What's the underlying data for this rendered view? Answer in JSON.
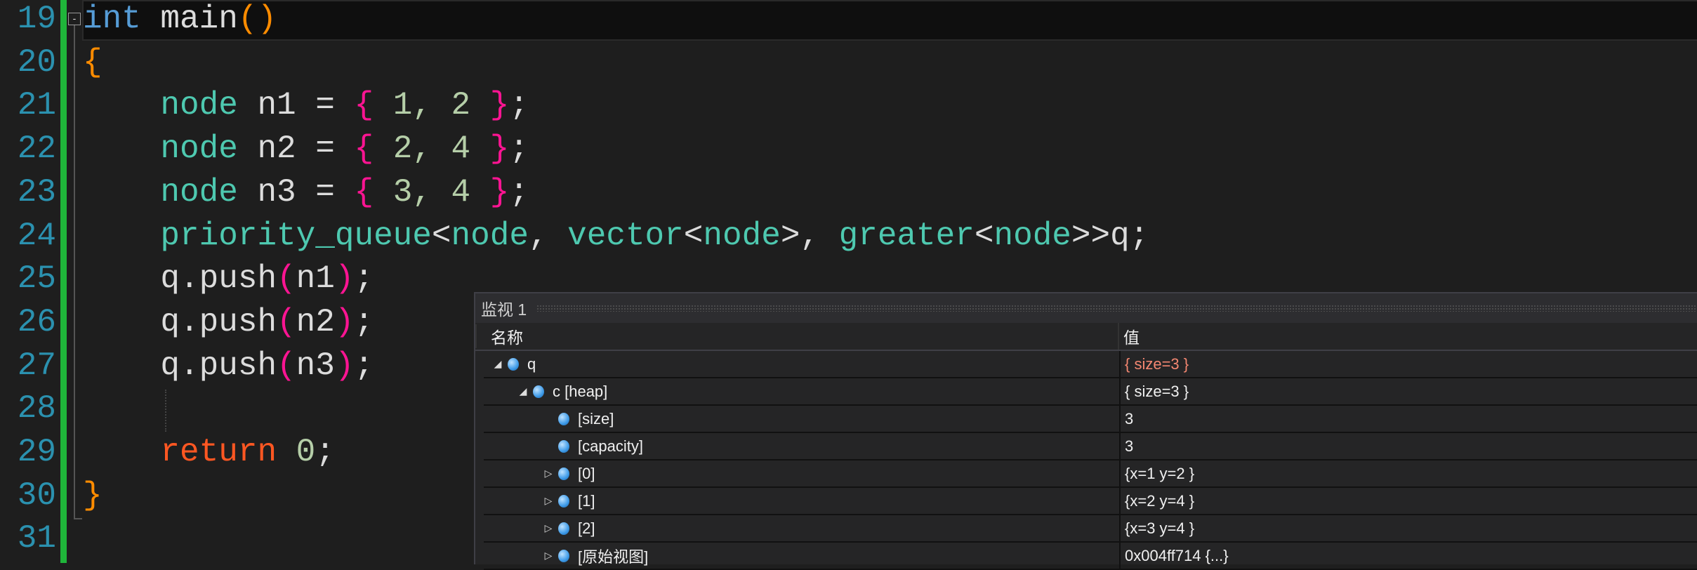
{
  "editor": {
    "lines": [
      {
        "n": "19",
        "tokens": [
          [
            "kw",
            "int"
          ],
          [
            "",
            "  main"
          ],
          [
            "pa",
            "()"
          ]
        ]
      },
      {
        "n": "20",
        "tokens": [
          [
            "pa",
            "{"
          ]
        ]
      },
      {
        "n": "21",
        "tokens": [
          [
            "",
            "    "
          ],
          [
            "ty",
            "node"
          ],
          [
            "",
            " n1 = "
          ],
          [
            "br",
            "{"
          ],
          [
            "num",
            " 1, 2 "
          ],
          [
            "br",
            "}"
          ],
          [
            "",
            ";"
          ]
        ]
      },
      {
        "n": "22",
        "tokens": [
          [
            "",
            "    "
          ],
          [
            "ty",
            "node"
          ],
          [
            "",
            " n2 = "
          ],
          [
            "br",
            "{"
          ],
          [
            "num",
            " 2, 4 "
          ],
          [
            "br",
            "}"
          ],
          [
            "",
            ";"
          ]
        ]
      },
      {
        "n": "23",
        "tokens": [
          [
            "",
            "    "
          ],
          [
            "ty",
            "node"
          ],
          [
            "",
            " n3 = "
          ],
          [
            "br",
            "{"
          ],
          [
            "num",
            " 3, 4 "
          ],
          [
            "br",
            "}"
          ],
          [
            "",
            ";"
          ]
        ]
      },
      {
        "n": "24",
        "tokens": [
          [
            "",
            "    "
          ],
          [
            "ty",
            "priority_queue"
          ],
          [
            "",
            "<"
          ],
          [
            "ty",
            "node"
          ],
          [
            "",
            ", "
          ],
          [
            "ty",
            "vector"
          ],
          [
            "",
            "<"
          ],
          [
            "ty",
            "node"
          ],
          [
            "",
            ">, "
          ],
          [
            "ty",
            "greater"
          ],
          [
            "",
            "<"
          ],
          [
            "ty",
            "node"
          ],
          [
            "",
            ">>q;"
          ]
        ]
      },
      {
        "n": "25",
        "tokens": [
          [
            "",
            "    q.push"
          ],
          [
            "br",
            "("
          ],
          [
            "",
            "n1"
          ],
          [
            "br",
            ")"
          ],
          [
            "",
            ";"
          ]
        ]
      },
      {
        "n": "26",
        "tokens": [
          [
            "",
            "    q.push"
          ],
          [
            "br",
            "("
          ],
          [
            "",
            "n2"
          ],
          [
            "br",
            ")"
          ],
          [
            "",
            ";"
          ]
        ]
      },
      {
        "n": "27",
        "tokens": [
          [
            "",
            "    q.push"
          ],
          [
            "br",
            "("
          ],
          [
            "",
            "n3"
          ],
          [
            "br",
            ")"
          ],
          [
            "",
            ";"
          ]
        ]
      },
      {
        "n": "28",
        "tokens": []
      },
      {
        "n": "29",
        "tokens": [
          [
            "",
            "    "
          ],
          [
            "ret",
            "return"
          ],
          [
            "num",
            " 0"
          ],
          [
            "",
            ";"
          ]
        ]
      },
      {
        "n": "30",
        "tokens": [
          [
            "pa",
            "}"
          ]
        ]
      },
      {
        "n": "31",
        "tokens": []
      }
    ]
  },
  "watch": {
    "title": "监视 1",
    "col_name": "名称",
    "col_value": "值",
    "rows": [
      {
        "indent": 0,
        "expander": "expanded",
        "name": "q",
        "value": "{ size=3 }",
        "changed": true
      },
      {
        "indent": 1,
        "expander": "expanded",
        "name": "c [heap]",
        "value": "{ size=3 }"
      },
      {
        "indent": 2,
        "expander": "none",
        "name": "[size]",
        "value": "3"
      },
      {
        "indent": 2,
        "expander": "none",
        "name": "[capacity]",
        "value": "3"
      },
      {
        "indent": 2,
        "expander": "collapsed",
        "name": "[0]",
        "value": "{x=1 y=2 }"
      },
      {
        "indent": 2,
        "expander": "collapsed",
        "name": "[1]",
        "value": "{x=2 y=4 }"
      },
      {
        "indent": 2,
        "expander": "collapsed",
        "name": "[2]",
        "value": "{x=3 y=4 }"
      },
      {
        "indent": 2,
        "expander": "collapsed",
        "name": "[原始视图]",
        "value": "0x004ff714 {...}"
      }
    ]
  }
}
